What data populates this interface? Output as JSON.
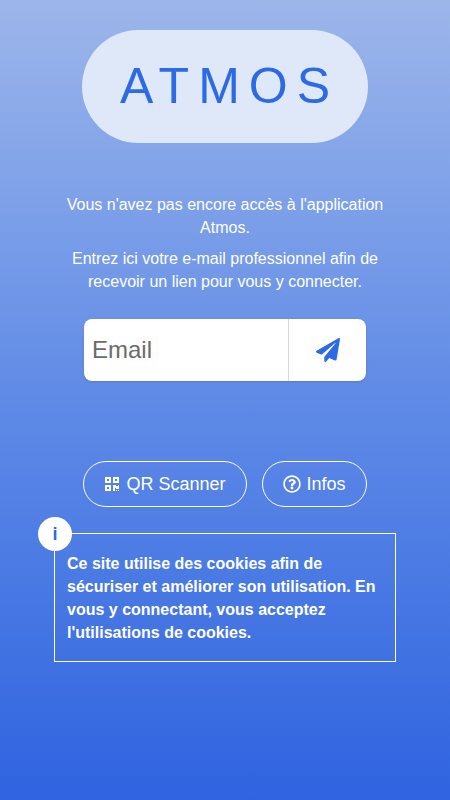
{
  "logo": "ATMOS",
  "messages": [
    "Vous n'avez pas encore accès à l'application Atmos.",
    "Entrez ici votre e-mail professionnel afin de recevoir un lien pour vous y connecter."
  ],
  "email": {
    "placeholder": "Email"
  },
  "buttons": [
    {
      "label": "QR Scanner",
      "kind": "qr"
    },
    {
      "label": "Infos",
      "kind": "info"
    }
  ],
  "cookie_notice": {
    "icon": "i",
    "text": "Ce site utilise des cookies afin de sécuriser et améliorer son utilisation. En vous y connectant, vous acceptez l'utilisations de cookies."
  }
}
